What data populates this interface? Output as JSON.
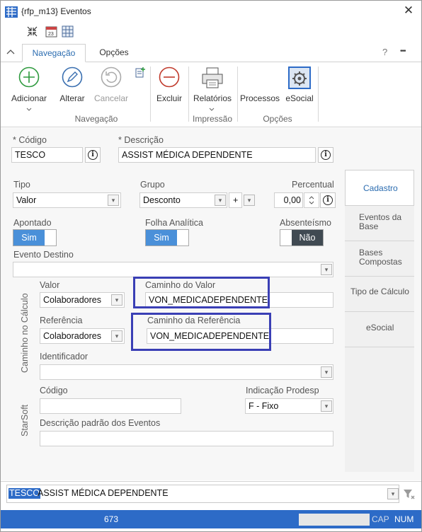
{
  "window": {
    "title": "{rfp_m13}  Eventos",
    "close_icon": "close-icon"
  },
  "tabs": [
    {
      "label": "Navegação",
      "active": true
    },
    {
      "label": "Opções",
      "active": false
    }
  ],
  "help": "?",
  "more": "•••",
  "ribbon": {
    "adicionar": "Adicionar",
    "alterar": "Alterar",
    "cancelar": "Cancelar",
    "excluir": "Excluir",
    "relatorios": "Relatórios",
    "processos": "Processos",
    "esocial": "eSocial",
    "groups": {
      "navegacao": "Navegação",
      "impressao": "Impressão",
      "opcoes": "Opções"
    }
  },
  "form": {
    "codigo_label": "* Código",
    "codigo_value": "TESCO",
    "descricao_label": "* Descrição",
    "descricao_value": "ASSIST MÉDICA DEPENDENTE",
    "tipo_label": "Tipo",
    "tipo_value": "Valor",
    "grupo_label": "Grupo",
    "grupo_value": "Desconto",
    "grupo_sign": "+",
    "percentual_label": "Percentual",
    "percentual_value": "0,00",
    "apontado_label": "Apontado",
    "apontado_value": "Sim",
    "folha_label": "Folha Analítica",
    "folha_value": "Sim",
    "absenteismo_label": "Absenteísmo",
    "absenteismo_value": "Não",
    "evento_destino_label": "Evento Destino",
    "evento_destino_value": "",
    "calc_section_label": "Caminho no Cálculo",
    "valor_label": "Valor",
    "valor_value": "Colaboradores",
    "caminho_valor_label": "Caminho do Valor",
    "caminho_valor_value": "VON_MEDICADEPENDENTE",
    "referencia_label": "Referência",
    "referencia_value": "Colaboradores",
    "caminho_ref_label": "Caminho da Referência",
    "caminho_ref_value": "VON_MEDICADEPENDENTE",
    "identificador_label": "Identificador",
    "identificador_value": "",
    "starsoft_label": "StarSoft",
    "codigo2_label": "Código",
    "codigo2_value": "",
    "indicacao_label": "Indicação Prodesp",
    "indicacao_value": "F - Fixo",
    "descricao_padrao_label": "Descrição padrão dos Eventos",
    "descricao_padrao_value": ""
  },
  "side_tabs": [
    {
      "label": "Cadastro",
      "active": true
    },
    {
      "label": "Eventos da Base",
      "active": false
    },
    {
      "label": "Bases Compostas",
      "active": false
    },
    {
      "label": "Tipo de Cálculo",
      "active": false
    },
    {
      "label": "eSocial",
      "active": false
    }
  ],
  "bottom": {
    "code": "TESCO",
    "desc": "ASSIST MÉDICA DEPENDENTE"
  },
  "status": {
    "count": "673",
    "cap": "CAP",
    "num": "NUM"
  },
  "colors": {
    "accent": "#2b6cb0",
    "toggle_on": "#4a90d9",
    "toggle_off": "#404a52",
    "highlight": "#3a3fb5",
    "statusbar": "#2d6bc7"
  }
}
